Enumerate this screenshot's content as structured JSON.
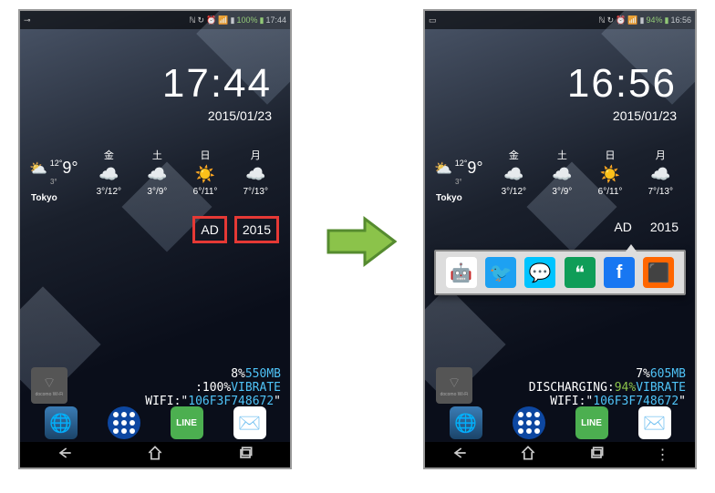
{
  "left": {
    "statusbar": {
      "battery": "100%",
      "time": "17:44"
    },
    "clock": {
      "time": "17:44",
      "date": "2015/01/23"
    },
    "current": {
      "hi": "12°",
      "lo": "3°",
      "temp": "9°",
      "city": "Tokyo"
    },
    "days": [
      {
        "d": "金",
        "t": "3°/12°"
      },
      {
        "d": "土",
        "t": "3°/9°"
      },
      {
        "d": "日",
        "t": "6°/11°"
      },
      {
        "d": "月",
        "t": "7°/13°"
      }
    ],
    "adrow": {
      "ad": "AD",
      "year": "2015"
    },
    "info": {
      "pct": "8%",
      "mb": "550MB",
      "p2": ":100%",
      "vib": "VIBRATE",
      "wifilbl": "WIFI:\"",
      "wifi": "106F3F748672",
      "q": "\""
    },
    "docomo": "docomo Wi-Fi"
  },
  "right": {
    "statusbar": {
      "battery": "94%",
      "time": "16:56"
    },
    "clock": {
      "time": "16:56",
      "date": "2015/01/23"
    },
    "current": {
      "hi": "12°",
      "lo": "3°",
      "temp": "9°",
      "city": "Tokyo"
    },
    "days": [
      {
        "d": "金",
        "t": "3°/12°"
      },
      {
        "d": "土",
        "t": "3°/9°"
      },
      {
        "d": "日",
        "t": "6°/11°"
      },
      {
        "d": "月",
        "t": "7°/13°"
      }
    ],
    "adrow": {
      "ad": "AD",
      "year": "2015"
    },
    "info": {
      "pct": "7%",
      "mb": "605MB",
      "dis": "DISCHARGING:",
      "dpct": "94%",
      "vib": "VIBRATE",
      "wifilbl": "WIFI:\"",
      "wifi": "106F3F748672",
      "q": "\""
    },
    "docomo": "docomo Wi-Fi"
  }
}
